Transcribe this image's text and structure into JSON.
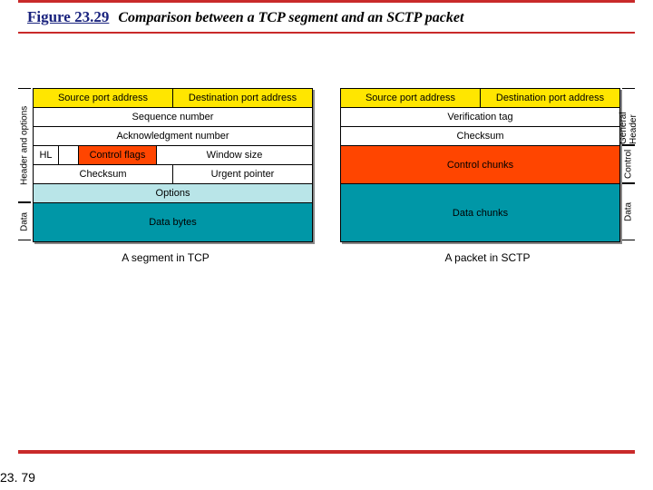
{
  "figure": {
    "label": "Figure 23.29",
    "title": "Comparison between a TCP segment and an SCTP packet"
  },
  "tcp": {
    "vlabel_header": "Header and options",
    "vlabel_data": "Data",
    "r1a": "Source port address",
    "r1b": "Destination port address",
    "r2": "Sequence number",
    "r3": "Acknowledgment number",
    "r4_hl": "HL",
    "r4_flags": "Control flags",
    "r4_win": "Window size",
    "r5a": "Checksum",
    "r5b": "Urgent pointer",
    "r6": "Options",
    "r7": "Data bytes",
    "caption": "A segment in TCP"
  },
  "sctp": {
    "vlabel_gh": "General Header",
    "vlabel_ctrl": "Control",
    "vlabel_data": "Data",
    "r1a": "Source port address",
    "r1b": "Destination port address",
    "r2": "Verification tag",
    "r3": "Checksum",
    "r4": "Control chunks",
    "r5": "Data chunks",
    "caption": "A packet in SCTP"
  },
  "page_number": "23. 79",
  "chart_data": {
    "type": "table",
    "title": "Comparison between a TCP segment and an SCTP packet",
    "panels": [
      {
        "name": "TCP segment",
        "sections": [
          {
            "label": "Header and options",
            "rows": [
              [
                "Source port address",
                "Destination port address"
              ],
              [
                "Sequence number"
              ],
              [
                "Acknowledgment number"
              ],
              [
                "HL",
                "",
                "Control flags",
                "Window size"
              ],
              [
                "Checksum",
                "Urgent pointer"
              ],
              [
                "Options"
              ]
            ]
          },
          {
            "label": "Data",
            "rows": [
              [
                "Data bytes"
              ]
            ]
          }
        ]
      },
      {
        "name": "SCTP packet",
        "sections": [
          {
            "label": "General Header",
            "rows": [
              [
                "Source port address",
                "Destination port address"
              ],
              [
                "Verification tag"
              ],
              [
                "Checksum"
              ]
            ]
          },
          {
            "label": "Control",
            "rows": [
              [
                "Control chunks"
              ]
            ]
          },
          {
            "label": "Data",
            "rows": [
              [
                "Data chunks"
              ]
            ]
          }
        ]
      }
    ]
  }
}
